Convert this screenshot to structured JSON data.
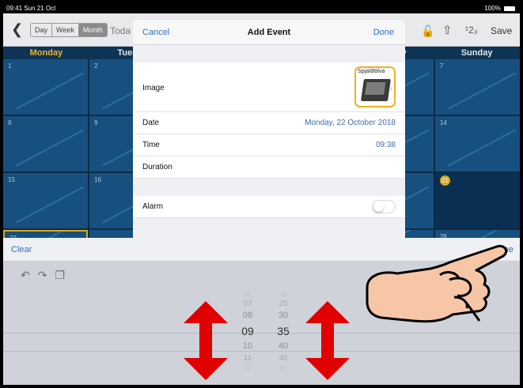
{
  "status": {
    "time": "09:41",
    "date": "Sun 21 Oct",
    "battery": "100%"
  },
  "toolbar": {
    "back_icon": "chevron-left-icon",
    "views": [
      "Day",
      "Week",
      "Month"
    ],
    "selected_view": "Month",
    "today_label": "Toda",
    "lock_icon": "lock-icon",
    "share_icon": "share-icon",
    "numbering_label": "¹2₃",
    "save_label": "Save"
  },
  "calendar": {
    "day_headers": [
      "Monday",
      "Tuesda",
      "",
      "",
      "aturday",
      "Sunday"
    ],
    "rows": [
      [
        "1",
        "2",
        "",
        "",
        "",
        "7"
      ],
      [
        "8",
        "9",
        "",
        "",
        "",
        "14"
      ],
      [
        "15",
        "16",
        "",
        "",
        "",
        "21"
      ],
      [
        "22",
        "",
        "",
        "",
        "",
        "28"
      ]
    ],
    "today": "21",
    "accent": "#d7a81e"
  },
  "modal": {
    "cancel_label": "Cancel",
    "title": "Add Event",
    "done_label": "Done",
    "image_label": "Image",
    "image_caption": "Spjaldtölva",
    "date_label": "Date",
    "date_value": "Monday, 22 October 2018",
    "time_label": "Time",
    "time_value": "09:38",
    "duration_label": "Duration",
    "alarm_label": "Alarm",
    "alarm_on": false
  },
  "picker": {
    "clear_label": "Clear",
    "done_label": "one",
    "hours": [
      "06",
      "07",
      "08",
      "09",
      "10",
      "11",
      "12"
    ],
    "minutes": [
      "20",
      "25",
      "30",
      "35",
      "40",
      "45",
      "50"
    ],
    "selected_hour": "09",
    "selected_minute": "35"
  }
}
